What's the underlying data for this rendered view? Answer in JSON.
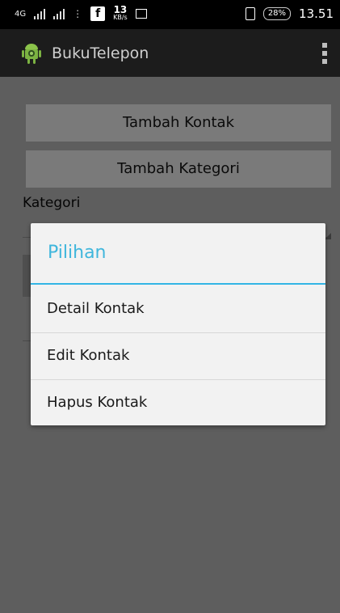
{
  "status_bar": {
    "network": "4G",
    "fb_label": "f",
    "speed_value": "13",
    "speed_unit": "KB/s",
    "battery": "28%",
    "time": "13.51"
  },
  "action_bar": {
    "title": "BukuTelepon",
    "app_icon": "android-icon",
    "overflow_icon": "overflow-menu-icon"
  },
  "main": {
    "add_contact_label": "Tambah Kontak",
    "add_category_label": "Tambah Kategori",
    "category_label": "Kategori"
  },
  "dialog": {
    "title": "Pilihan",
    "items": [
      {
        "label": "Detail Kontak"
      },
      {
        "label": "Edit Kontak"
      },
      {
        "label": "Hapus Kontak"
      }
    ]
  },
  "colors": {
    "accent": "#33b5e5",
    "title_blue": "#3fb6dc",
    "android_green": "#8bc34a"
  }
}
